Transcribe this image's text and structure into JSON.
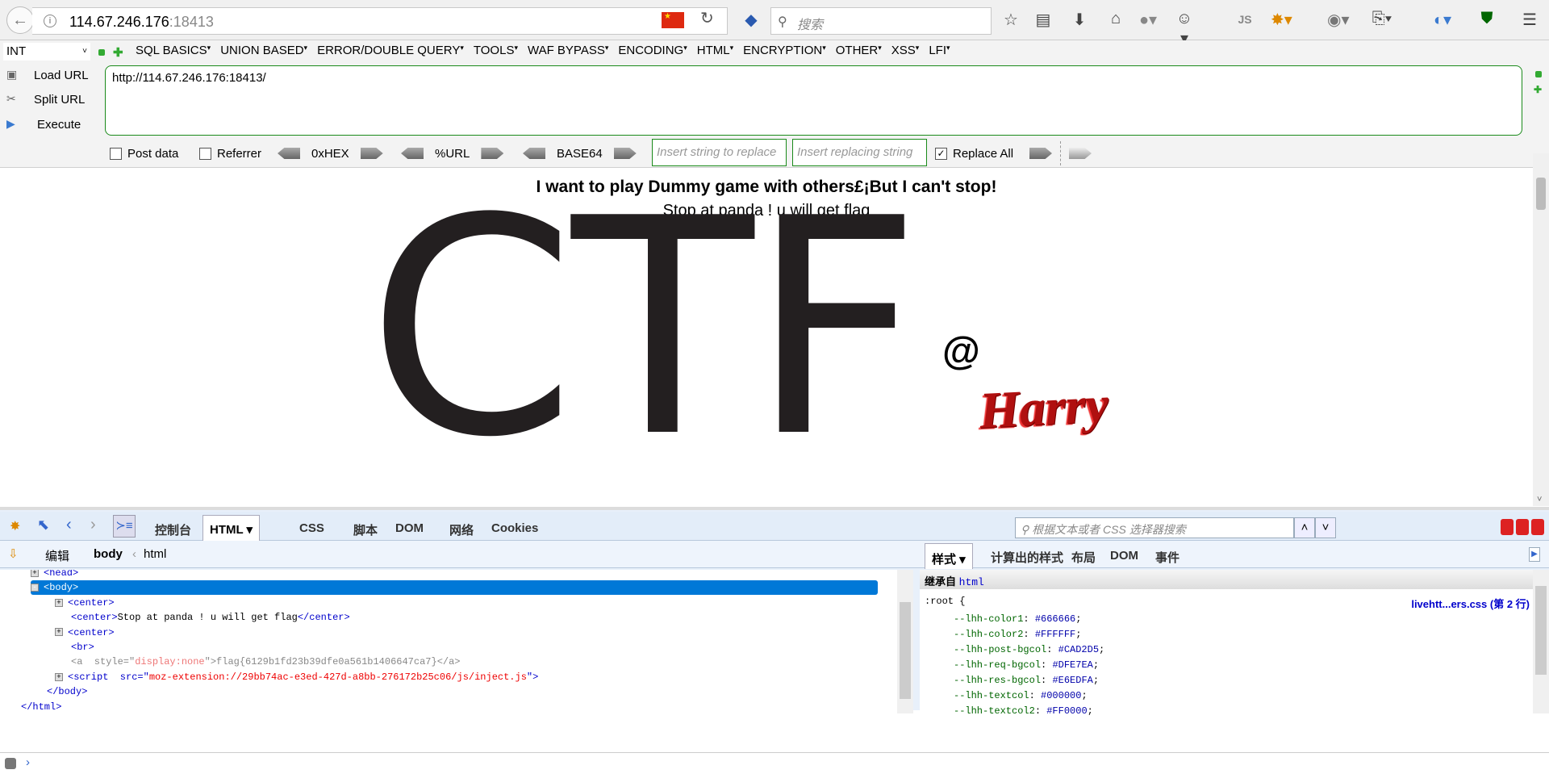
{
  "browser": {
    "url_host": "114.67.246.176",
    "url_port": ":18413",
    "search_placeholder": "搜索",
    "toolbar_icons": [
      "star-icon",
      "reading-list-icon",
      "download-icon",
      "home-icon",
      "extension-globe-icon",
      "palette-icon",
      "js-icon",
      "firebug-icon",
      "proxy-icon",
      "screenshot-icon",
      "translate-icon",
      "shield-icon",
      "menu-icon"
    ],
    "js_label": "JS"
  },
  "hackbar": {
    "type_select": "INT",
    "menus": [
      "SQL BASICS",
      "UNION BASED",
      "ERROR/DOUBLE QUERY",
      "TOOLS",
      "WAF BYPASS",
      "ENCODING",
      "HTML",
      "ENCRYPTION",
      "OTHER",
      "XSS",
      "LFI"
    ],
    "load_url": "Load URL",
    "split_url": "Split URL",
    "execute": "Execute",
    "url_value": "http://114.67.246.176:18413/",
    "post_data": "Post data",
    "referrer": "Referrer",
    "hex": "0xHEX",
    "url_enc": "%URL",
    "base64": "BASE64",
    "replace_placeholder": "Insert string to replace",
    "replacing_placeholder": "Insert replacing string",
    "replace_all": "Replace All",
    "replace_all_checked": true,
    "accent": "#1a8a1a"
  },
  "page": {
    "heading": "I want to play Dummy game with others£¡But I can't stop!",
    "subtitle": "Stop at panda ! u will get flag",
    "logo_text": "CTF",
    "logo_at": "@",
    "logo_name": "Harry"
  },
  "devtools": {
    "tabs": [
      "控制台",
      "HTML",
      "CSS",
      "脚本",
      "DOM",
      "网络",
      "Cookies"
    ],
    "active_tab": "HTML",
    "search_placeholder": "根据文本或者 CSS 选择器搜索",
    "edit": "编辑",
    "crumb_current": "body",
    "crumb_parent": "html",
    "side_tabs": [
      "样式",
      "计算出的样式",
      "布局",
      "DOM",
      "事件"
    ],
    "inherited_label": "继承自",
    "inherited_from": "html",
    "rule_selector": ":root {",
    "rule_source": "livehtt...ers.css (第 2 行)",
    "properties": [
      {
        "name": "--lhh-color1",
        "value": "#666666"
      },
      {
        "name": "--lhh-color2",
        "value": "#FFFFFF"
      },
      {
        "name": "--lhh-post-bgcol",
        "value": "#CAD2D5"
      },
      {
        "name": "--lhh-req-bgcol",
        "value": "#DFE7EA"
      },
      {
        "name": "--lhh-res-bgcol",
        "value": "#E6EDFA"
      },
      {
        "name": "--lhh-textcol",
        "value": "#000000"
      },
      {
        "name": "--lhh-textcol2",
        "value": "#FF0000"
      }
    ],
    "tree": [
      {
        "level": 1,
        "exp": "+",
        "segs": [
          {
            "k": "tag",
            "t": "<head>"
          }
        ]
      },
      {
        "level": 1,
        "exp": "-",
        "selected": true,
        "segs": [
          {
            "k": "tag",
            "t": "<body>"
          }
        ]
      },
      {
        "level": 2,
        "exp": "+",
        "segs": [
          {
            "k": "tag",
            "t": "<center>"
          }
        ]
      },
      {
        "level": 2,
        "segs": [
          {
            "k": "tag",
            "t": "<center>"
          },
          {
            "k": "text",
            "t": "Stop at panda ! u will get flag"
          },
          {
            "k": "tag",
            "t": "</center>"
          }
        ]
      },
      {
        "level": 2,
        "exp": "+",
        "segs": [
          {
            "k": "tag",
            "t": "<center>"
          }
        ]
      },
      {
        "level": 2,
        "segs": [
          {
            "k": "tag",
            "t": "<br>"
          }
        ]
      },
      {
        "level": 2,
        "segs": [
          {
            "k": "dim",
            "t": "<a  style=\""
          },
          {
            "k": "dimval",
            "t": "display:none"
          },
          {
            "k": "dim",
            "t": "\">flag{6129b1fd23b39dfe0a561b1406647ca7}</a>"
          }
        ]
      },
      {
        "level": 2,
        "exp": "+",
        "segs": [
          {
            "k": "tag",
            "t": "<script  src=\""
          },
          {
            "k": "val",
            "t": "moz-extension://29bb74ac-e3ed-427d-a8bb-276172b25c06/js/inject.js"
          },
          {
            "k": "tag",
            "t": "\">"
          }
        ]
      },
      {
        "level": 1,
        "close": true,
        "segs": [
          {
            "k": "tag",
            "t": "</body>"
          }
        ]
      },
      {
        "level": 0,
        "close": true,
        "segs": [
          {
            "k": "tag",
            "t": "</html>"
          }
        ]
      }
    ]
  }
}
